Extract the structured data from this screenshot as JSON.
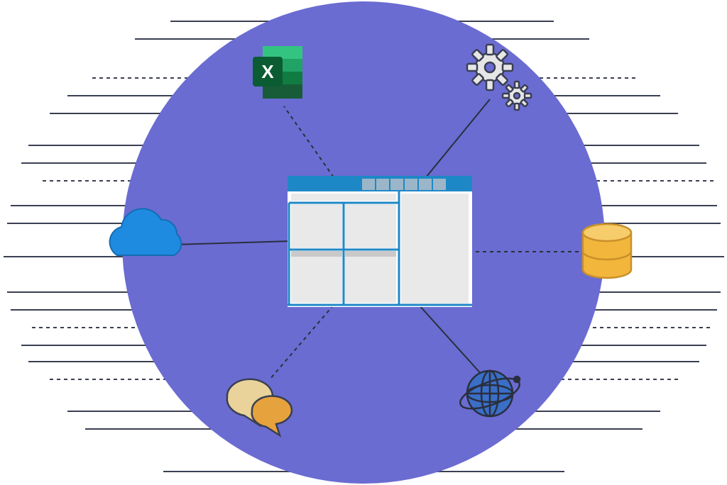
{
  "diagram": {
    "circle_color": "#6A6CD1",
    "line_color": "#3A3F52",
    "center_app": {
      "frame_color": "#1E88C7",
      "panel_color": "#E9E9E9"
    },
    "nodes": {
      "excel": {
        "name": "excel-icon",
        "label": "X",
        "green_dark": "#185C37",
        "green_mid": "#21A366",
        "green_light": "#33C481",
        "badge": "#107C41"
      },
      "gears": {
        "name": "gears-icon",
        "fill": "#E6E6E6",
        "stroke": "#3A3F52"
      },
      "cloud": {
        "name": "cloud-icon",
        "fill": "#1E8BE0",
        "stroke": "#1E8BE0"
      },
      "database": {
        "name": "database-icon",
        "fill": "#F2B63C",
        "stroke": "#C9902A"
      },
      "chat": {
        "name": "chat-icon",
        "bubble1": "#E9D39A",
        "bubble2": "#E6A23C",
        "stroke": "#3A3F52"
      },
      "globe": {
        "name": "globe-icon",
        "fill": "#3A6EC7",
        "stroke": "#2A2F3E"
      }
    }
  }
}
